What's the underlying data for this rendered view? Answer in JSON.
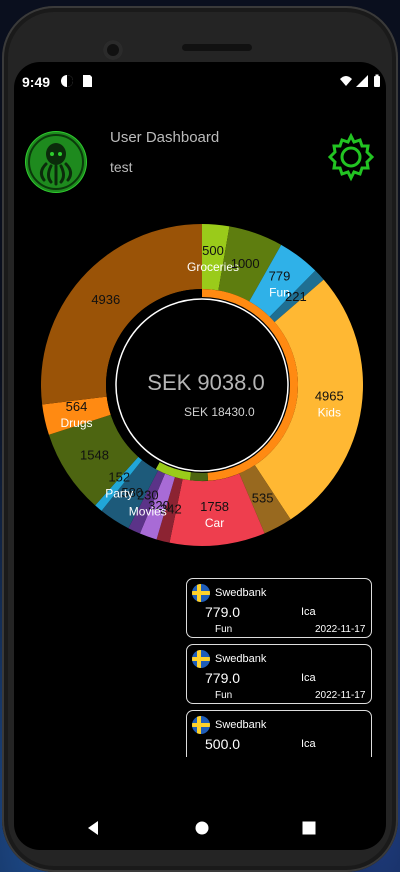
{
  "status_bar": {
    "time": "9:49"
  },
  "header": {
    "title": "User Dashboard",
    "username": "test"
  },
  "center": {
    "amount": "SEK 9038.0",
    "total": "SEK 18430.0"
  },
  "chart_data": {
    "type": "pie",
    "title": "",
    "outer_ring": [
      {
        "label": "Groceries",
        "value": 500,
        "color": "#9acb1a"
      },
      {
        "label": "",
        "value": 1000,
        "color": "#5e7d0f"
      },
      {
        "label": "Fun",
        "value": 779,
        "color": "#2fb1e8"
      },
      {
        "label": "",
        "value": 221,
        "color": "#1f6f92"
      },
      {
        "label": "Kids",
        "value": 4965,
        "color": "#ffb833"
      },
      {
        "label": "",
        "value": 535,
        "color": "#98691f"
      },
      {
        "label": "Car",
        "value": 1758,
        "color": "#ee3e4e"
      },
      {
        "label": "",
        "value": 242,
        "color": "#8c2332"
      },
      {
        "label": "",
        "value": 320,
        "color": "#a86bd6"
      },
      {
        "label": "Movies",
        "value": 230,
        "color": "#5b3388"
      },
      {
        "label": "",
        "value": 580,
        "color": "#1d5a7a"
      },
      {
        "label": "Party",
        "value": 152,
        "color": "#21a6d8"
      },
      {
        "label": "",
        "value": 1548,
        "color": "#4d6511"
      },
      {
        "label": "Drugs",
        "value": 564,
        "color": "#ff8a12"
      },
      {
        "label": "",
        "value": 4936,
        "color": "#9a5307"
      }
    ],
    "inner_ring": [
      {
        "label": "",
        "value": 0.49,
        "color": "#ff8a12"
      },
      {
        "label": "",
        "value": 0.03,
        "color": "#4d6511"
      },
      {
        "label": "",
        "value": 0.06,
        "color": "#9acb1a"
      },
      {
        "label": "",
        "value": 0.42,
        "color": "#000000"
      }
    ]
  },
  "transactions": [
    {
      "bank": "Swedbank",
      "amount": "779.0",
      "merchant": "Ica",
      "category": "Fun",
      "date": "2022-11-17"
    },
    {
      "bank": "Swedbank",
      "amount": "779.0",
      "merchant": "Ica",
      "category": "Fun",
      "date": "2022-11-17"
    },
    {
      "bank": "Swedbank",
      "amount": "500.0",
      "merchant": "Ica",
      "category": "",
      "date": ""
    }
  ],
  "colors": {
    "accent_green": "#2ecc2e"
  }
}
